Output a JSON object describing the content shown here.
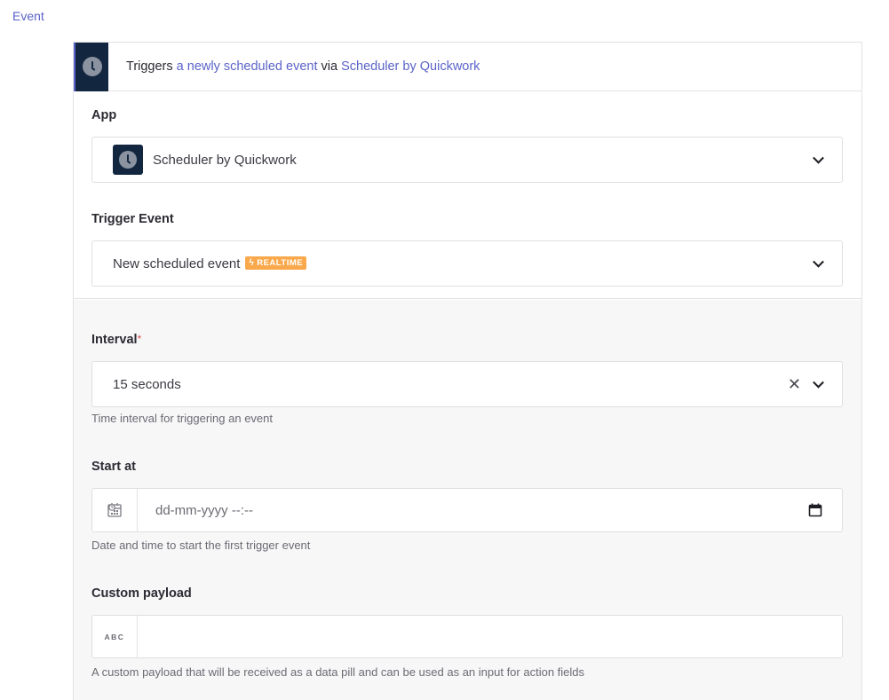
{
  "section": {
    "label": "Event"
  },
  "summary": {
    "prefix": "Triggers",
    "event_link": "a newly scheduled event",
    "middle": "via",
    "app_link": "Scheduler by Quickwork"
  },
  "app_field": {
    "label": "App",
    "value": "Scheduler by Quickwork",
    "icon": "clock-icon"
  },
  "trigger_field": {
    "label": "Trigger Event",
    "value": "New scheduled event",
    "badge": "REALTIME",
    "badge_icon": "bolt-icon"
  },
  "interval_field": {
    "label": "Interval",
    "required_mark": "*",
    "value": "15 seconds",
    "help": "Time interval for triggering an event"
  },
  "start_field": {
    "label": "Start at",
    "placeholder": "dd-mm-yyyy --:--",
    "help": "Date and time to start the first trigger event"
  },
  "payload_field": {
    "label": "Custom payload",
    "prefix": "ABC",
    "value": "",
    "help": "A custom payload that will be received as a data pill and can be used as an input for action fields"
  },
  "colors": {
    "accent": "#5a63c8",
    "app_icon_bg": "#12263f",
    "badge": "#f9a84b",
    "required": "#d9534f"
  }
}
